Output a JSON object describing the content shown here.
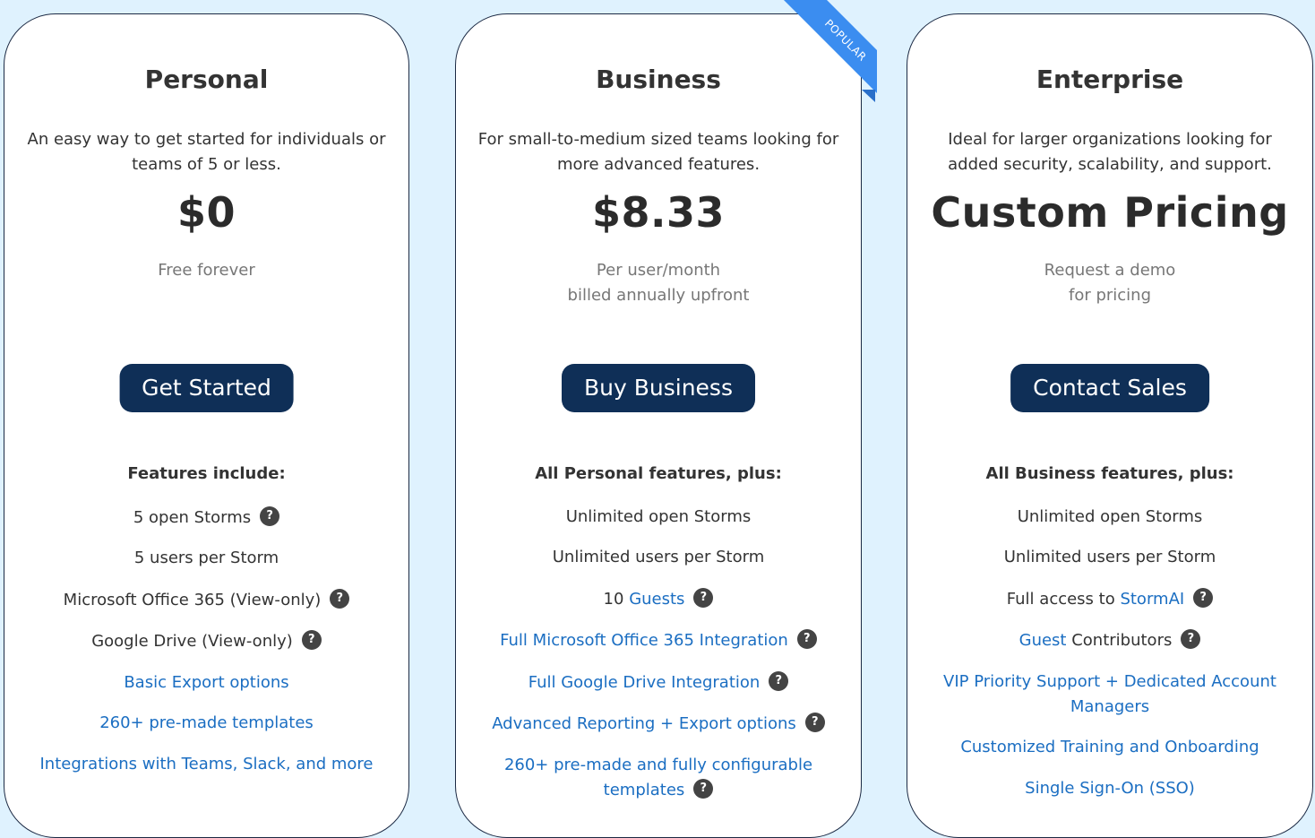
{
  "colors": {
    "background": "#dff2fe",
    "button": "#0f2f57",
    "link": "#1b6ec2",
    "ribbon": "#3b8df0"
  },
  "plans": [
    {
      "title": "Personal",
      "description": "An easy way to get started for individuals or teams of 5 or less.",
      "price": "$0",
      "billing": [
        "Free forever"
      ],
      "cta": "Get Started",
      "features_heading": "Features include:",
      "features": [
        {
          "text": "5 open Storms",
          "link": "",
          "help": true
        },
        {
          "text": "5 users per Storm",
          "link": "",
          "help": false
        },
        {
          "text": "Microsoft Office 365 (View-only)",
          "link": "",
          "help": true
        },
        {
          "text": "Google Drive (View-only)",
          "link": "",
          "help": true
        },
        {
          "text": "",
          "link": "Basic Export options",
          "help": false
        },
        {
          "text": "",
          "link": "260+ pre-made templates",
          "help": false
        },
        {
          "text": "",
          "link": "Integrations with Teams, Slack, and more",
          "help": false
        }
      ]
    },
    {
      "title": "Business",
      "description": "For small-to-medium sized teams looking for more advanced features.",
      "price": "$8.33",
      "billing": [
        "Per user/month",
        "billed annually upfront"
      ],
      "cta": "Buy Business",
      "badge": "POPULAR",
      "features_heading": "All Personal features, plus:",
      "features": [
        {
          "text": "Unlimited open Storms",
          "link": "",
          "help": false
        },
        {
          "text": "Unlimited users per Storm",
          "link": "",
          "help": false
        },
        {
          "text": "10 ",
          "link": "Guests",
          "help": true
        },
        {
          "text": "",
          "link": "Full Microsoft Office 365 Integration",
          "help": true
        },
        {
          "text": "",
          "link": "Full Google Drive Integration",
          "help": true
        },
        {
          "text": "",
          "link": "Advanced Reporting + Export options",
          "help": true
        },
        {
          "text": "",
          "link": "260+ pre-made and fully configurable templates",
          "help": true
        }
      ]
    },
    {
      "title": "Enterprise",
      "description": "Ideal for larger organizations looking for added security, scalability, and support.",
      "price": "Custom Pricing",
      "billing": [
        "Request a demo",
        "for pricing"
      ],
      "cta": "Contact Sales",
      "features_heading": "All Business features, plus:",
      "features": [
        {
          "text": "Unlimited open Storms",
          "link": "",
          "help": false
        },
        {
          "text": "Unlimited users per Storm",
          "link": "",
          "help": false
        },
        {
          "text": "Full access to ",
          "link": "StormAI",
          "help": true
        },
        {
          "text": " Contributors",
          "link": "Guest",
          "help": true,
          "link_first": true
        },
        {
          "text": "",
          "link": "VIP Priority Support + Dedicated Account Managers",
          "help": false
        },
        {
          "text": "",
          "link": "Customized Training and Onboarding",
          "help": false
        },
        {
          "text": "",
          "link": "Single Sign-On (SSO)",
          "help": false
        }
      ]
    }
  ],
  "help_glyph": "?"
}
